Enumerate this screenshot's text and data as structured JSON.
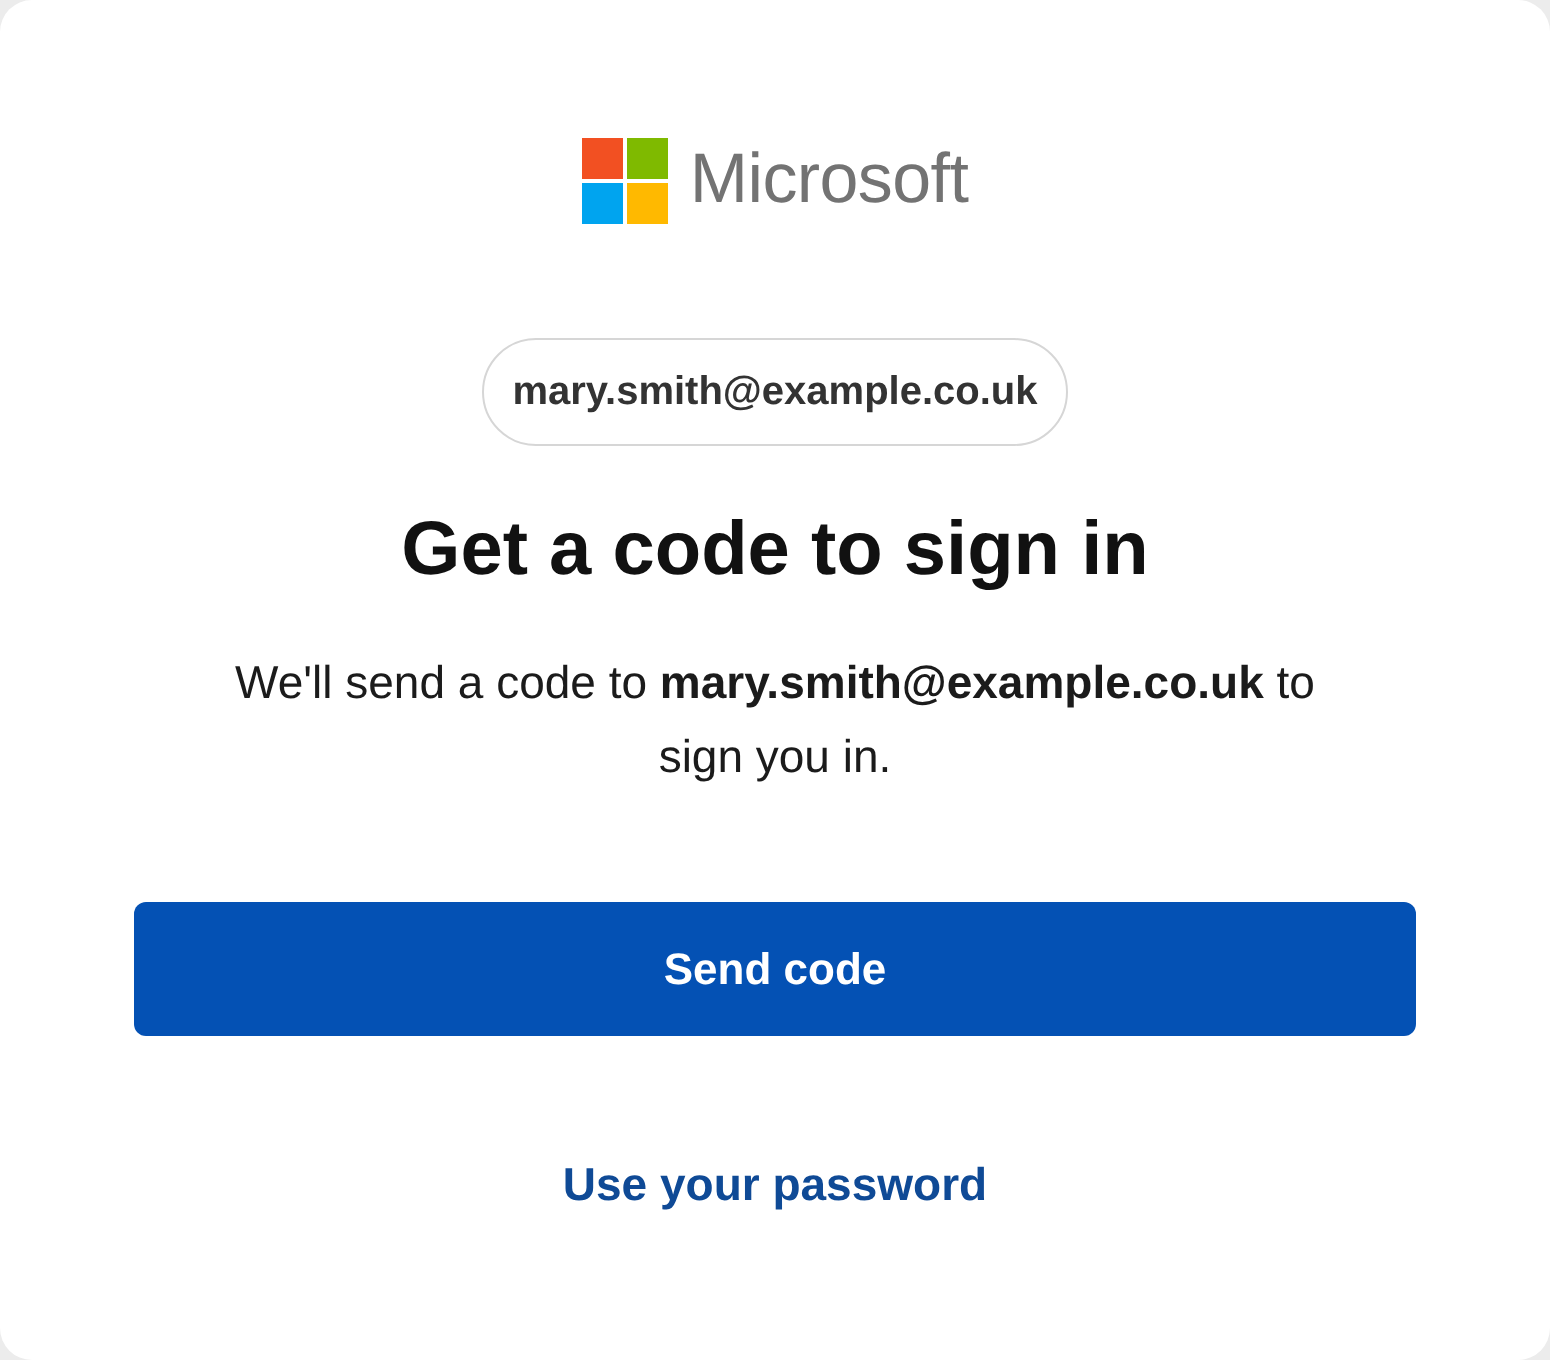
{
  "logo": {
    "wordmark": "Microsoft"
  },
  "account": {
    "email": "mary.smith@example.co.uk"
  },
  "heading": "Get a code to sign in",
  "message": "We'll send a code to **mary.smith@example.co.uk** to sign you in.",
  "primary_button": {
    "label": "Send code"
  },
  "alternate_link": {
    "label": "Use your password"
  }
}
